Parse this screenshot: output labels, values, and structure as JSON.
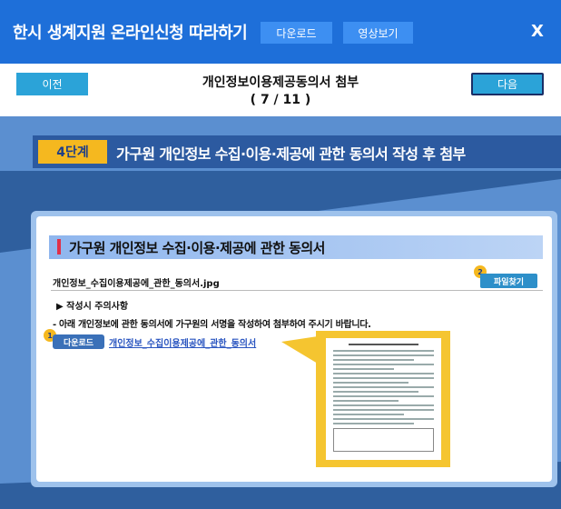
{
  "header": {
    "title": "한시 생계지원 온라인신청 따라하기",
    "download_label": "다운로드",
    "video_label": "영상보기",
    "close_label": "X"
  },
  "nav": {
    "prev_label": "이전",
    "next_label": "다음",
    "step_title": "개인정보이용제공동의서 첨부",
    "step_count": "( 7 / 11 )"
  },
  "guide": {
    "step_badge": "4단계",
    "step_heading": "가구원 개인정보 수집·이용·제공에 관한 동의서 작성 후 첨부",
    "card_title": "가구원 개인정보 수집·이용·제공에 관한 동의서",
    "file_name": "개인정보_수집이용제공에_관한_동의서.jpg",
    "find_button": "파일찾기",
    "badge_2": "2",
    "badge_1": "1",
    "note_title": "▶ 작성시 주의사항",
    "note_text": "- 아래 개인정보에 관한 동의서에 가구원의 서명을 작성하여 첨부하여 주시기 바랍니다.",
    "download_button": "다운로드",
    "download_link": "개인정보_수집이용제공에_관한_동의서"
  }
}
